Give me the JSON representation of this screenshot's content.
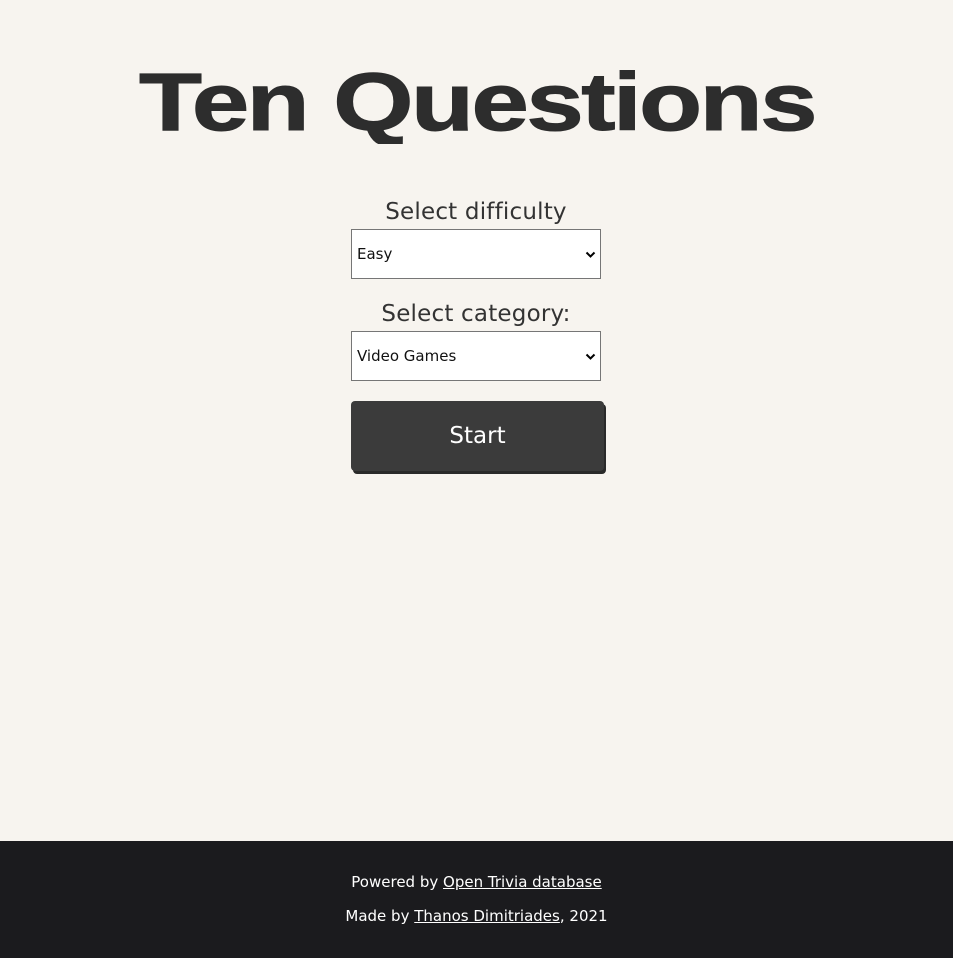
{
  "logo": {
    "text": "Ten Questions",
    "color": "#2d2d2d"
  },
  "difficulty": {
    "label": "Select difficulty",
    "selected": "Easy"
  },
  "category": {
    "label": "Select category:",
    "selected": "Video Games"
  },
  "start": {
    "label": "Start"
  },
  "footer": {
    "powered_prefix": "Powered by",
    "powered_link": "Open Trivia database",
    "made_prefix": "Made by",
    "made_link": "Thanos Dimitriades",
    "made_suffix": ", 2021"
  },
  "colors": {
    "background": "#f7f4ef",
    "button": "#3b3b3b",
    "footer": "#1b1b1e"
  }
}
